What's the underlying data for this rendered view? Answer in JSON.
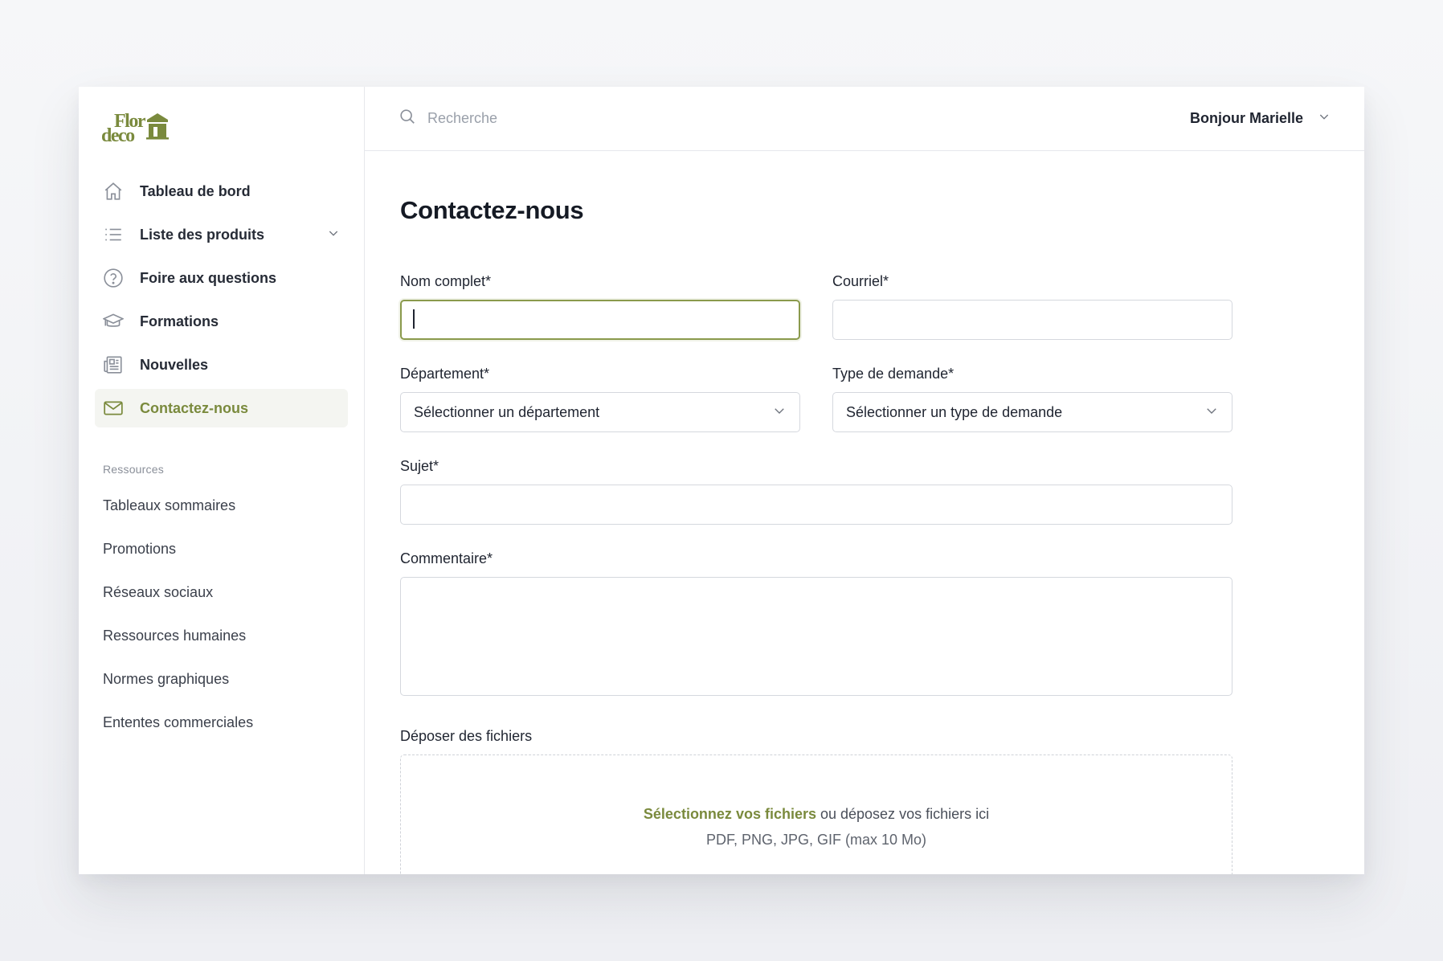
{
  "brand": {
    "line1": "Flor",
    "line2": "deco",
    "color": "#7a8a3d"
  },
  "nav": {
    "items": [
      {
        "label": "Tableau de bord",
        "icon": "home-icon"
      },
      {
        "label": "Liste des produits",
        "icon": "list-icon",
        "expandable": true
      },
      {
        "label": "Foire aux questions",
        "icon": "help-circle-icon"
      },
      {
        "label": "Formations",
        "icon": "graduation-cap-icon"
      },
      {
        "label": "Nouvelles",
        "icon": "newspaper-icon"
      },
      {
        "label": "Contactez-nous",
        "icon": "mail-icon",
        "active": true
      }
    ]
  },
  "resources": {
    "title": "Ressources",
    "items": [
      "Tableaux sommaires",
      "Promotions",
      "Réseaux sociaux",
      "Ressources humaines",
      "Normes graphiques",
      "Ententes commerciales"
    ]
  },
  "topbar": {
    "search_placeholder": "Recherche",
    "greeting": "Bonjour Marielle"
  },
  "page": {
    "title": "Contactez-nous"
  },
  "form": {
    "full_name": {
      "label": "Nom complet*",
      "value": ""
    },
    "email": {
      "label": "Courriel*",
      "value": ""
    },
    "department": {
      "label": "Département*",
      "selected": "Sélectionner un département"
    },
    "request_type": {
      "label": "Type de demande*",
      "selected": "Sélectionner un type de demande"
    },
    "subject": {
      "label": "Sujet*",
      "value": ""
    },
    "comment": {
      "label": "Commentaire*",
      "value": ""
    },
    "files": {
      "label": "Déposer des fichiers",
      "link": "Sélectionnez vos fichiers",
      "text": " ou déposez vos fichiers ici",
      "hint": "PDF, PNG, JPG, GIF (max 10 Mo)"
    }
  },
  "colors": {
    "accent": "#7a8a3d",
    "active_bg": "#f4f5f1",
    "border": "#d5d8de"
  }
}
